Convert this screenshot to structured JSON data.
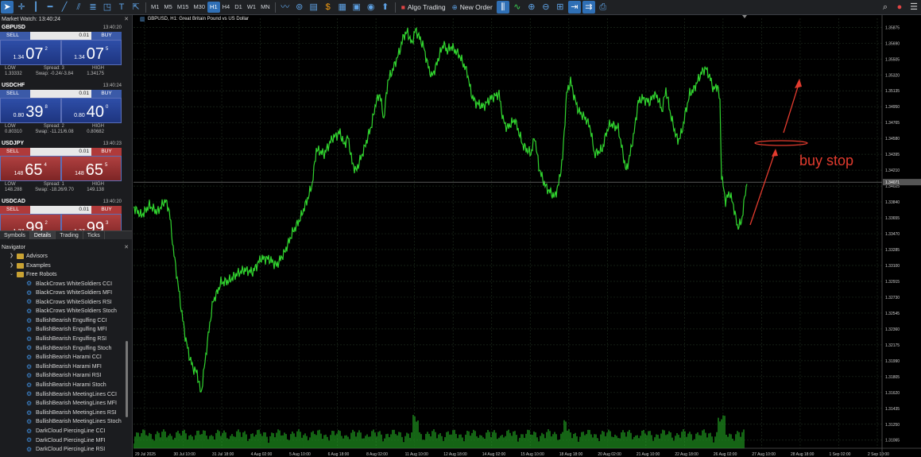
{
  "toolbar": {
    "timeframes": [
      "M1",
      "M5",
      "M15",
      "M30",
      "H1",
      "H4",
      "D1",
      "W1",
      "MN"
    ],
    "active_timeframe": "H1",
    "algo_trading": "Algo Trading",
    "new_order": "New Order"
  },
  "market_watch": {
    "title": "Market Watch: 13:40:24",
    "symbols": [
      {
        "name": "GBPUSD",
        "time": "13:40:20",
        "sell": "SELL",
        "buy": "BUY",
        "lot": "0.01",
        "bid_prefix": "1.34",
        "bid_big": "07",
        "bid_sup": "2",
        "ask_prefix": "1.34",
        "ask_big": "07",
        "ask_sup": "5",
        "low_label": "LOW",
        "spread": "Spread: 3",
        "high_label": "HIGH",
        "low": "1.33332",
        "swap": "Swap: -0.24/-3.84",
        "high": "1.34175",
        "color": "blue"
      },
      {
        "name": "USDCHF",
        "time": "13:40:24",
        "sell": "SELL",
        "buy": "BUY",
        "lot": "0.01",
        "bid_prefix": "0.80",
        "bid_big": "39",
        "bid_sup": "8",
        "ask_prefix": "0.80",
        "ask_big": "40",
        "ask_sup": "0",
        "low_label": "LOW",
        "spread": "Spread: 2",
        "high_label": "HIGH",
        "low": "0.80310",
        "swap": "Swap: -11.21/6.08",
        "high": "0.80682",
        "color": "blue"
      },
      {
        "name": "USDJPY",
        "time": "13:40:23",
        "sell": "SELL",
        "buy": "BUY",
        "lot": "0.01",
        "bid_prefix": "148",
        "bid_big": "65",
        "bid_sup": "4",
        "ask_prefix": "148",
        "ask_big": "65",
        "ask_sup": "5",
        "low_label": "LOW",
        "spread": "Spread: 1",
        "high_label": "HIGH",
        "low": "148.288",
        "swap": "Swap: -18.26/9.70",
        "high": "149.138",
        "color": "red"
      },
      {
        "name": "USDCAD",
        "time": "13:40:20",
        "sell": "SELL",
        "buy": "BUY",
        "lot": "0.01",
        "bid_prefix": "1.37",
        "bid_big": "99",
        "bid_sup": "2",
        "ask_prefix": "1.37",
        "ask_big": "99",
        "ask_sup": "3",
        "color": "red"
      }
    ]
  },
  "tabs": [
    "Symbols",
    "Details",
    "Trading",
    "Ticks"
  ],
  "navigator": {
    "title": "Navigator",
    "folders": [
      "Advisors",
      "Examples",
      "Free Robots"
    ],
    "robots": [
      "BlackCrows WhiteSoldiers CCI",
      "BlackCrows WhiteSoldiers MFI",
      "BlackCrows WhiteSoldiers RSI",
      "BlackCrows WhiteSoldiers Stoch",
      "BullishBearish Engulfing CCI",
      "BullishBearish Engulfing MFI",
      "BullishBearish Engulfing RSI",
      "BullishBearish Engulfing Stoch",
      "BullishBearish Harami CCI",
      "BullishBearish Harami MFI",
      "BullishBearish Harami RSI",
      "BullishBearish Harami Stoch",
      "BullishBearish MeetingLines CCI",
      "BullishBearish MeetingLines MFI",
      "BullishBearish MeetingLines RSI",
      "BullishBearish MeetingLines Stoch",
      "DarkCloud PiercingLine CCI",
      "DarkCloud PiercingLine MFI",
      "DarkCloud PiercingLine RSI"
    ]
  },
  "chart": {
    "title": "GBPUSD, H1:  Great Britain Pound vs US Dollar",
    "annotation": "buy stop",
    "colors": {
      "line": "#31d42f",
      "annotation": "#e23b2e",
      "grid": "#1c2a1c"
    }
  },
  "chart_data": {
    "type": "line",
    "title": "GBPUSD, H1:  Great Britain Pound vs US Dollar",
    "y_ticks": [
      "1.35875",
      "1.35690",
      "1.35505",
      "1.35320",
      "1.35135",
      "1.34950",
      "1.34765",
      "1.34580",
      "1.34395",
      "1.34210",
      "1.34025",
      "1.33840",
      "1.33655",
      "1.33470",
      "1.33285",
      "1.33100",
      "1.32915",
      "1.32730",
      "1.32545",
      "1.32360",
      "1.32175",
      "1.31990",
      "1.31805",
      "1.31620",
      "1.31435",
      "1.31250",
      "1.31065"
    ],
    "x_ticks": [
      "29 Jul 2025",
      "30 Jul 10:00",
      "31 Jul 18:00",
      "4 Aug 02:00",
      "5 Aug 10:00",
      "6 Aug 18:00",
      "8 Aug 02:00",
      "11 Aug 10:00",
      "12 Aug 18:00",
      "14 Aug 02:00",
      "15 Aug 10:00",
      "18 Aug 18:00",
      "20 Aug 02:00",
      "21 Aug 10:00",
      "22 Aug 18:00",
      "26 Aug 02:00",
      "27 Aug 10:00",
      "28 Aug 18:00",
      "1 Sep 02:00",
      "2 Sep 10:00"
    ],
    "current_price": "1.34071",
    "ylim": [
      1.3097,
      1.3598
    ],
    "path": [
      [
        0,
        1.3378
      ],
      [
        10,
        1.3368
      ],
      [
        20,
        1.338
      ],
      [
        30,
        1.3372
      ],
      [
        40,
        1.3386
      ],
      [
        45,
        1.3374
      ],
      [
        50,
        1.333
      ],
      [
        55,
        1.3295
      ],
      [
        60,
        1.326
      ],
      [
        65,
        1.3228
      ],
      [
        70,
        1.3205
      ],
      [
        75,
        1.319
      ],
      [
        80,
        1.3185
      ],
      [
        85,
        1.316
      ],
      [
        90,
        1.3198
      ],
      [
        95,
        1.3235
      ],
      [
        100,
        1.3268
      ],
      [
        105,
        1.3278
      ],
      [
        110,
        1.329
      ],
      [
        120,
        1.3292
      ],
      [
        130,
        1.33
      ],
      [
        140,
        1.3305
      ],
      [
        150,
        1.3302
      ],
      [
        160,
        1.3318
      ],
      [
        170,
        1.3318
      ],
      [
        180,
        1.331
      ],
      [
        190,
        1.3325
      ],
      [
        200,
        1.3348
      ],
      [
        210,
        1.3365
      ],
      [
        220,
        1.339
      ],
      [
        225,
        1.3405
      ],
      [
        230,
        1.3445
      ],
      [
        240,
        1.344
      ],
      [
        250,
        1.3458
      ],
      [
        260,
        1.3465
      ],
      [
        265,
        1.345
      ],
      [
        270,
        1.346
      ],
      [
        275,
        1.343
      ],
      [
        280,
        1.342
      ],
      [
        290,
        1.3445
      ],
      [
        300,
        1.3475
      ],
      [
        305,
        1.35
      ],
      [
        310,
        1.351
      ],
      [
        315,
        1.348
      ],
      [
        320,
        1.3525
      ],
      [
        325,
        1.3535
      ],
      [
        335,
        1.356
      ],
      [
        340,
        1.3578
      ],
      [
        345,
        1.3582
      ],
      [
        350,
        1.3568
      ],
      [
        355,
        1.3585
      ],
      [
        360,
        1.3575
      ],
      [
        365,
        1.3565
      ],
      [
        370,
        1.3545
      ],
      [
        375,
        1.353
      ],
      [
        380,
        1.354
      ],
      [
        385,
        1.3555
      ],
      [
        390,
        1.3568
      ],
      [
        395,
        1.356
      ],
      [
        400,
        1.3565
      ],
      [
        405,
        1.356
      ],
      [
        410,
        1.3555
      ],
      [
        415,
        1.3545
      ],
      [
        420,
        1.3535
      ],
      [
        425,
        1.351
      ],
      [
        430,
        1.35
      ],
      [
        440,
        1.3495
      ],
      [
        450,
        1.3505
      ],
      [
        460,
        1.351
      ],
      [
        465,
        1.348
      ],
      [
        470,
        1.347
      ],
      [
        480,
        1.348
      ],
      [
        490,
        1.345
      ],
      [
        500,
        1.344
      ],
      [
        505,
        1.346
      ],
      [
        510,
        1.3425
      ],
      [
        515,
        1.341
      ],
      [
        520,
        1.34
      ],
      [
        530,
        1.339
      ],
      [
        535,
        1.3405
      ],
      [
        540,
        1.3435
      ],
      [
        545,
        1.351
      ],
      [
        550,
        1.3525
      ],
      [
        555,
        1.3505
      ],
      [
        560,
        1.349
      ],
      [
        570,
        1.348
      ],
      [
        575,
        1.347
      ],
      [
        580,
        1.344
      ],
      [
        590,
        1.3445
      ],
      [
        595,
        1.3465
      ],
      [
        600,
        1.3475
      ],
      [
        610,
        1.347
      ],
      [
        615,
        1.3445
      ],
      [
        620,
        1.342
      ],
      [
        625,
        1.344
      ],
      [
        630,
        1.3465
      ],
      [
        635,
        1.35
      ],
      [
        640,
        1.3505
      ],
      [
        650,
        1.35
      ],
      [
        655,
        1.351
      ],
      [
        660,
        1.3505
      ],
      [
        665,
        1.349
      ],
      [
        670,
        1.3515
      ],
      [
        675,
        1.349
      ],
      [
        680,
        1.347
      ],
      [
        685,
        1.3455
      ],
      [
        690,
        1.3465
      ],
      [
        695,
        1.349
      ],
      [
        700,
        1.351
      ],
      [
        705,
        1.3515
      ],
      [
        710,
        1.3525
      ],
      [
        715,
        1.3535
      ],
      [
        720,
        1.354
      ],
      [
        725,
        1.353
      ],
      [
        730,
        1.3515
      ],
      [
        735,
        1.352
      ],
      [
        738,
        1.35
      ],
      [
        740,
        1.3415
      ],
      [
        745,
        1.3385
      ],
      [
        750,
        1.3395
      ],
      [
        755,
        1.338
      ],
      [
        760,
        1.3355
      ],
      [
        765,
        1.336
      ],
      [
        770,
        1.3395
      ],
      [
        772,
        1.3405
      ]
    ]
  }
}
